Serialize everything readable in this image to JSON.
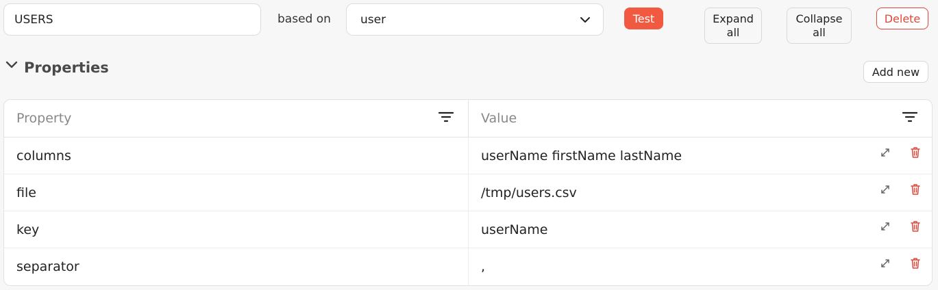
{
  "header": {
    "name_value": "USERS",
    "based_on_label": "based on",
    "based_on_value": "user",
    "test_label": "Test",
    "expand_label_1": "Expand",
    "expand_label_2": "all",
    "collapse_label_1": "Collapse",
    "collapse_label_2": "all",
    "delete_label": "Delete"
  },
  "section": {
    "title": "Properties",
    "add_label": "Add new"
  },
  "table": {
    "columns": [
      "Property",
      "Value"
    ],
    "rows": [
      {
        "property": "columns",
        "value": "userName firstName lastName"
      },
      {
        "property": "file",
        "value": "/tmp/users.csv"
      },
      {
        "property": "key",
        "value": "userName"
      },
      {
        "property": "separator",
        "value": ","
      }
    ]
  },
  "icons": {
    "select_arrow": "chevron-down-icon",
    "section_toggle": "chevron-down-icon",
    "filter": "filter-icon",
    "expand_row": "expand-icon",
    "delete_row": "trash-icon"
  },
  "colors": {
    "accent": "#f15a40",
    "danger": "#e0463a"
  }
}
